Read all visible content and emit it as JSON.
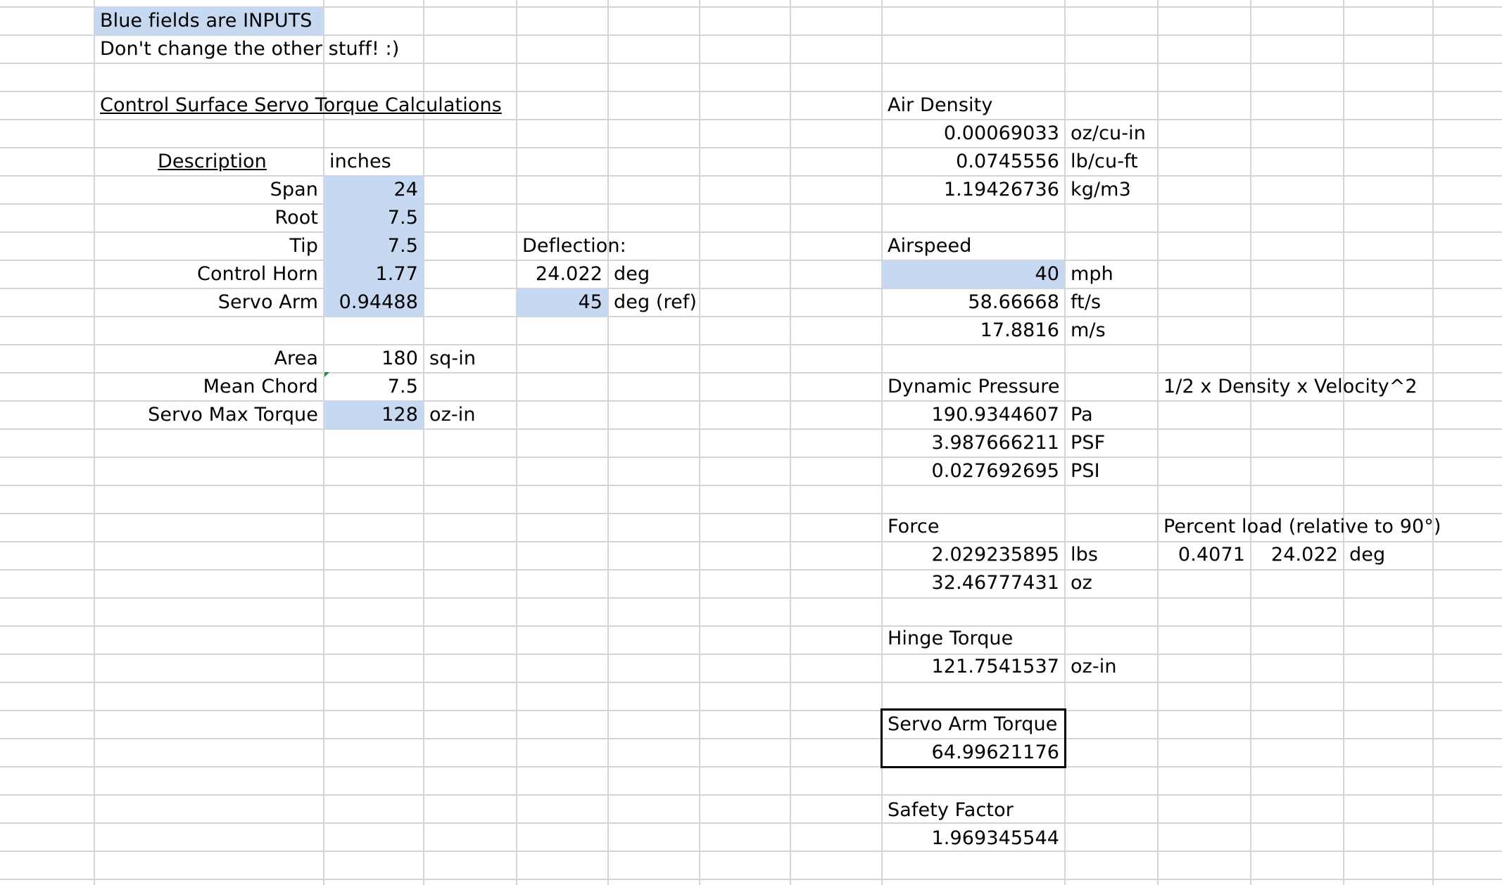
{
  "notes": {
    "line1": "Blue fields are INPUTS",
    "line2": "Don't change the other stuff! :)"
  },
  "title": "Control Surface Servo Torque Calculations",
  "inputs": {
    "description_header": "Description",
    "units_header": "inches",
    "rows": [
      {
        "label": "Span",
        "value": "24"
      },
      {
        "label": "Root",
        "value": "7.5"
      },
      {
        "label": "Tip",
        "value": "7.5"
      },
      {
        "label": "Control Horn",
        "value": "1.77"
      },
      {
        "label": "Servo Arm",
        "value": "0.94488"
      }
    ],
    "area": {
      "label": "Area",
      "value": "180",
      "unit": "sq-in"
    },
    "mean_chord": {
      "label": "Mean Chord",
      "value": "7.5"
    },
    "servo_max_torque": {
      "label": "Servo Max Torque",
      "value": "128",
      "unit": "oz-in"
    }
  },
  "deflection": {
    "label": "Deflection:",
    "value": "24.022",
    "unit": "deg",
    "ref_value": "45",
    "ref_unit": "deg (ref)"
  },
  "air_density": {
    "label": "Air Density",
    "rows": [
      {
        "value": "0.00069033",
        "unit": "oz/cu-in"
      },
      {
        "value": "0.0745556",
        "unit": "lb/cu-ft"
      },
      {
        "value": "1.19426736",
        "unit": "kg/m3"
      }
    ]
  },
  "airspeed": {
    "label": "Airspeed",
    "rows": [
      {
        "value": "40",
        "unit": "mph"
      },
      {
        "value": "58.66668",
        "unit": "ft/s"
      },
      {
        "value": "17.8816",
        "unit": "m/s"
      }
    ]
  },
  "dynamic_pressure": {
    "label": "Dynamic Pressure",
    "formula": "1/2 x Density x Velocity^2",
    "rows": [
      {
        "value": "190.9344607",
        "unit": "Pa"
      },
      {
        "value": "3.987666211",
        "unit": "PSF"
      },
      {
        "value": "0.027692695",
        "unit": "PSI"
      }
    ]
  },
  "force": {
    "label": "Force",
    "rows": [
      {
        "value": "2.029235895",
        "unit": "lbs"
      },
      {
        "value": "32.46777431",
        "unit": "oz"
      }
    ]
  },
  "percent_load": {
    "label": "Percent load (relative to 90°)",
    "value": "0.4071",
    "deflection_value": "24.022",
    "deflection_unit": "deg"
  },
  "hinge_torque": {
    "label": "Hinge Torque",
    "value": "121.7541537",
    "unit": "oz-in"
  },
  "servo_arm_torque": {
    "label": "Servo Arm Torque",
    "value": "64.99621176"
  },
  "safety_factor": {
    "label": "Safety Factor",
    "value": "1.969345544"
  },
  "colors": {
    "input_fill": "#c6d9f1",
    "gridline": "#d4d4d4",
    "note_marker": "#1e8c3a"
  }
}
